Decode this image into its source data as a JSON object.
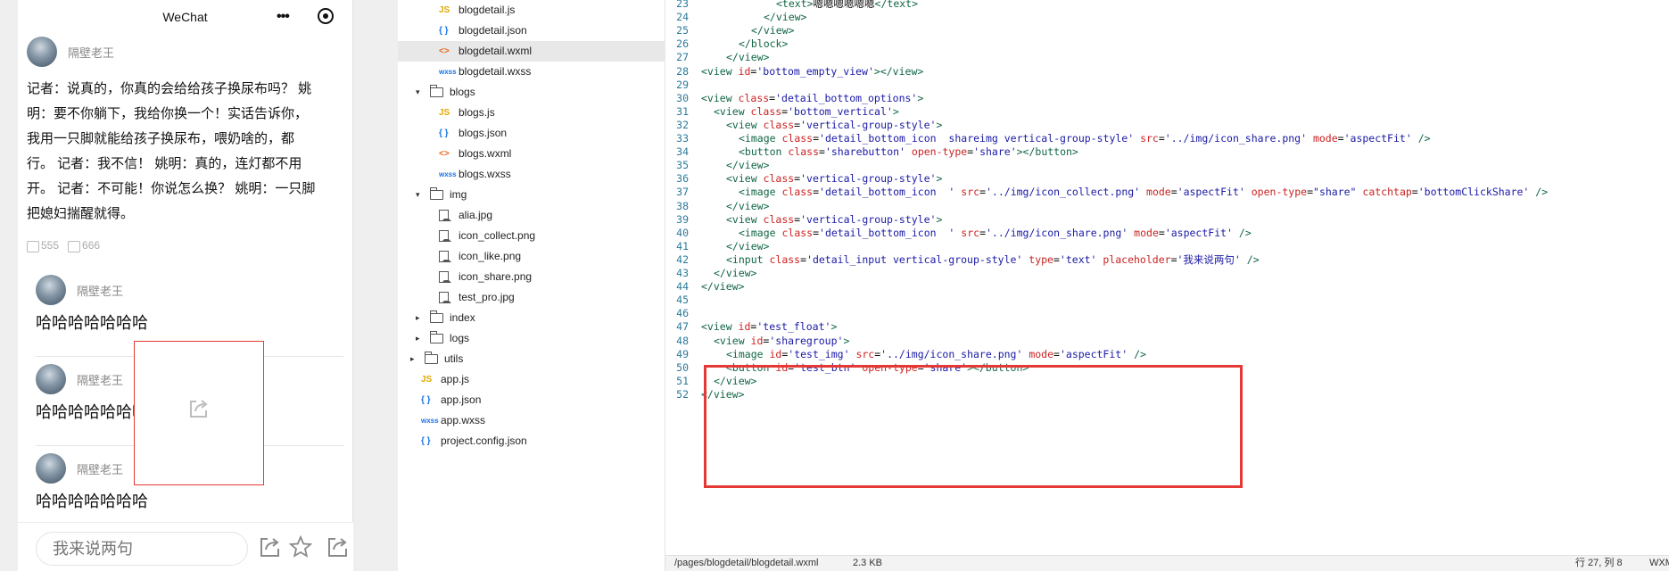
{
  "phone": {
    "nav_title": "WeChat",
    "nav_more": "•••",
    "author": "隔壁老王",
    "article_lines": [
      "记者：说真的，你真的会给给孩子换尿布吗？ 姚",
      "明：要不你躺下，我给你换一个！实话告诉你，",
      "我用一只脚就能给孩子换尿布，喂奶啥的，都",
      "行。 记者：我不信！ 姚明：真的，连灯都不用",
      "开。 记者：不可能！你说怎么换？ 姚明：一只脚",
      "把媳妇揣醒就得。"
    ],
    "likes": [
      "555",
      "666"
    ],
    "comments": [
      {
        "name": "隔壁老王",
        "text": "哈哈哈哈哈哈哈"
      },
      {
        "name": "隔壁老王",
        "text": "哈哈哈哈哈哈哈"
      },
      {
        "name": "隔壁老王",
        "text": "哈哈哈哈哈哈哈"
      }
    ],
    "input_placeholder": "我来说两句"
  },
  "tree": {
    "items": [
      {
        "type": "js",
        "icon": "JS",
        "label": "blogdetail.js"
      },
      {
        "type": "json",
        "icon": "{ }",
        "label": "blogdetail.json"
      },
      {
        "type": "wxml",
        "icon": "<>",
        "label": "blogdetail.wxml"
      },
      {
        "type": "wxss",
        "icon": "wxss",
        "label": "blogdetail.wxss"
      },
      {
        "type": "folder-open",
        "icon": "▾",
        "label": "blogs"
      },
      {
        "type": "js",
        "icon": "JS",
        "label": "blogs.js"
      },
      {
        "type": "json",
        "icon": "{ }",
        "label": "blogs.json"
      },
      {
        "type": "wxml",
        "icon": "<>",
        "label": "blogs.wxml"
      },
      {
        "type": "wxss",
        "icon": "wxss",
        "label": "blogs.wxss"
      },
      {
        "type": "folder-open",
        "icon": "▾",
        "label": "img"
      },
      {
        "type": "image",
        "icon": "",
        "label": "alia.jpg"
      },
      {
        "type": "image",
        "icon": "",
        "label": "icon_collect.png"
      },
      {
        "type": "image",
        "icon": "",
        "label": "icon_like.png"
      },
      {
        "type": "image",
        "icon": "",
        "label": "icon_share.png"
      },
      {
        "type": "image",
        "icon": "",
        "label": "test_pro.jpg"
      },
      {
        "type": "folder-closed",
        "icon": "▸",
        "label": "index"
      },
      {
        "type": "folder-closed",
        "icon": "▸",
        "label": "logs"
      },
      {
        "type": "folder-closed",
        "icon": "▸",
        "label": "utils"
      },
      {
        "type": "js",
        "icon": "JS",
        "label": "app.js"
      },
      {
        "type": "json",
        "icon": "{ }",
        "label": "app.json"
      },
      {
        "type": "wxss",
        "icon": "wxss",
        "label": "app.wxss"
      },
      {
        "type": "json",
        "icon": "{ }",
        "label": "project.config.json"
      }
    ],
    "selected": "blogdetail.wxml"
  },
  "editor": {
    "lines": [
      {
        "n": "23",
        "tokens": [
          [
            "tg",
            "<text>"
          ],
          [
            "tx",
            "嗯嗯嗯嗯嗯嗯"
          ],
          [
            "tg",
            "</text>"
          ]
        ]
      },
      {
        "n": "24",
        "tokens": [
          [
            "tg",
            "</view>"
          ]
        ]
      },
      {
        "n": "25",
        "tokens": [
          [
            "tg",
            "</view>"
          ]
        ]
      },
      {
        "n": "26",
        "tokens": [
          [
            "tg",
            "</block>"
          ]
        ]
      },
      {
        "n": "27",
        "tokens": [
          [
            "tg",
            "</view>"
          ]
        ]
      },
      {
        "n": "28",
        "tokens": [
          [
            "tg",
            "<view "
          ],
          [
            "at",
            "id"
          ],
          [
            "pn",
            "="
          ],
          [
            "st",
            "'bottom_empty_view'"
          ],
          [
            "tg",
            "></view>"
          ]
        ]
      },
      {
        "n": "29",
        "tokens": []
      },
      {
        "n": "30",
        "tokens": [
          [
            "tg",
            "<view "
          ],
          [
            "at",
            "class"
          ],
          [
            "pn",
            "="
          ],
          [
            "st",
            "'detail_bottom_options'"
          ],
          [
            "tg",
            ">"
          ]
        ]
      },
      {
        "n": "31",
        "tokens": [
          [
            "tg",
            "<view "
          ],
          [
            "at",
            "class"
          ],
          [
            "pn",
            "="
          ],
          [
            "st",
            "'bottom_vertical'"
          ],
          [
            "tg",
            ">"
          ]
        ]
      },
      {
        "n": "32",
        "tokens": [
          [
            "tg",
            "<view "
          ],
          [
            "at",
            "class"
          ],
          [
            "pn",
            "="
          ],
          [
            "st",
            "'vertical-group-style'"
          ],
          [
            "tg",
            ">"
          ]
        ]
      },
      {
        "n": "33",
        "tokens": [
          [
            "tg",
            "<image "
          ],
          [
            "at",
            "class"
          ],
          [
            "pn",
            "="
          ],
          [
            "st",
            "'detail_bottom_icon  shareimg vertical-group-style'"
          ],
          [
            "at",
            " src"
          ],
          [
            "pn",
            "="
          ],
          [
            "st",
            "'../img/icon_share.png'"
          ],
          [
            "at",
            " mode"
          ],
          [
            "pn",
            "="
          ],
          [
            "st",
            "'aspectFit'"
          ],
          [
            "tg",
            " />"
          ]
        ]
      },
      {
        "n": "34",
        "tokens": [
          [
            "tg",
            "<button "
          ],
          [
            "at",
            "class"
          ],
          [
            "pn",
            "="
          ],
          [
            "st",
            "'sharebutton'"
          ],
          [
            "at",
            " open-type"
          ],
          [
            "pn",
            "="
          ],
          [
            "st",
            "'share'"
          ],
          [
            "tg",
            "></button>"
          ]
        ]
      },
      {
        "n": "35",
        "tokens": [
          [
            "tg",
            "</view>"
          ]
        ]
      },
      {
        "n": "36",
        "tokens": [
          [
            "tg",
            "<view "
          ],
          [
            "at",
            "class"
          ],
          [
            "pn",
            "="
          ],
          [
            "st",
            "'vertical-group-style'"
          ],
          [
            "tg",
            ">"
          ]
        ]
      },
      {
        "n": "37",
        "tokens": [
          [
            "tg",
            "<image "
          ],
          [
            "at",
            "class"
          ],
          [
            "pn",
            "="
          ],
          [
            "st",
            "'detail_bottom_icon  '"
          ],
          [
            "at",
            " src"
          ],
          [
            "pn",
            "="
          ],
          [
            "st",
            "'../img/icon_collect.png'"
          ],
          [
            "at",
            " mode"
          ],
          [
            "pn",
            "="
          ],
          [
            "st",
            "'aspectFit'"
          ],
          [
            "at",
            " open-type"
          ],
          [
            "pn",
            "="
          ],
          [
            "st",
            "\"share\""
          ],
          [
            "at",
            " catchtap"
          ],
          [
            "pn",
            "="
          ],
          [
            "st",
            "'bottomClickShare'"
          ],
          [
            "tg",
            " />"
          ]
        ]
      },
      {
        "n": "38",
        "tokens": [
          [
            "tg",
            "</view>"
          ]
        ]
      },
      {
        "n": "39",
        "tokens": [
          [
            "tg",
            "<view "
          ],
          [
            "at",
            "class"
          ],
          [
            "pn",
            "="
          ],
          [
            "st",
            "'vertical-group-style'"
          ],
          [
            "tg",
            ">"
          ]
        ]
      },
      {
        "n": "40",
        "tokens": [
          [
            "tg",
            "<image "
          ],
          [
            "at",
            "class"
          ],
          [
            "pn",
            "="
          ],
          [
            "st",
            "'detail_bottom_icon  '"
          ],
          [
            "at",
            " src"
          ],
          [
            "pn",
            "="
          ],
          [
            "st",
            "'../img/icon_share.png'"
          ],
          [
            "at",
            " mode"
          ],
          [
            "pn",
            "="
          ],
          [
            "st",
            "'aspectFit'"
          ],
          [
            "tg",
            " />"
          ]
        ]
      },
      {
        "n": "41",
        "tokens": [
          [
            "tg",
            "</view>"
          ]
        ]
      },
      {
        "n": "42",
        "tokens": [
          [
            "tg",
            "<input "
          ],
          [
            "at",
            "class"
          ],
          [
            "pn",
            "="
          ],
          [
            "st",
            "'detail_input vertical-group-style'"
          ],
          [
            "at",
            " type"
          ],
          [
            "pn",
            "="
          ],
          [
            "st",
            "'text'"
          ],
          [
            "at",
            " placeholder"
          ],
          [
            "pn",
            "="
          ],
          [
            "st",
            "'我来说两句'"
          ],
          [
            "tg",
            " />"
          ]
        ]
      },
      {
        "n": "43",
        "tokens": [
          [
            "tg",
            "</view>"
          ]
        ]
      },
      {
        "n": "44",
        "tokens": [
          [
            "tg",
            "</view>"
          ]
        ]
      },
      {
        "n": "45",
        "tokens": []
      },
      {
        "n": "46",
        "tokens": []
      },
      {
        "n": "47",
        "tokens": [
          [
            "tg",
            "<view "
          ],
          [
            "at",
            "id"
          ],
          [
            "pn",
            "="
          ],
          [
            "st",
            "'test_float'"
          ],
          [
            "tg",
            ">"
          ]
        ]
      },
      {
        "n": "48",
        "tokens": [
          [
            "tg",
            "<view "
          ],
          [
            "at",
            "id"
          ],
          [
            "pn",
            "="
          ],
          [
            "st",
            "'sharegroup'"
          ],
          [
            "tg",
            ">"
          ]
        ]
      },
      {
        "n": "49",
        "tokens": [
          [
            "tg",
            "<image "
          ],
          [
            "at",
            "id"
          ],
          [
            "pn",
            "="
          ],
          [
            "st",
            "'test_img'"
          ],
          [
            "at",
            " src"
          ],
          [
            "pn",
            "="
          ],
          [
            "st",
            "'../img/icon_share.png'"
          ],
          [
            "at",
            " mode"
          ],
          [
            "pn",
            "="
          ],
          [
            "st",
            "'aspectFit'"
          ],
          [
            "tg",
            " />"
          ]
        ]
      },
      {
        "n": "50",
        "tokens": [
          [
            "tg",
            "<button "
          ],
          [
            "at",
            "id"
          ],
          [
            "pn",
            "="
          ],
          [
            "st",
            "'test_btn'"
          ],
          [
            "at",
            " open-type"
          ],
          [
            "pn",
            "="
          ],
          [
            "st",
            "'share'"
          ],
          [
            "tg",
            "></button>"
          ]
        ]
      },
      {
        "n": "51",
        "tokens": [
          [
            "tg",
            "</view>"
          ]
        ]
      },
      {
        "n": "52",
        "tokens": [
          [
            "tg",
            "</view>"
          ]
        ]
      }
    ]
  },
  "status": {
    "path": "/pages/blogdetail/blogdetail.wxml",
    "size": "2.3 KB",
    "cursor": "行 27, 列 8",
    "lang": "WXM"
  }
}
